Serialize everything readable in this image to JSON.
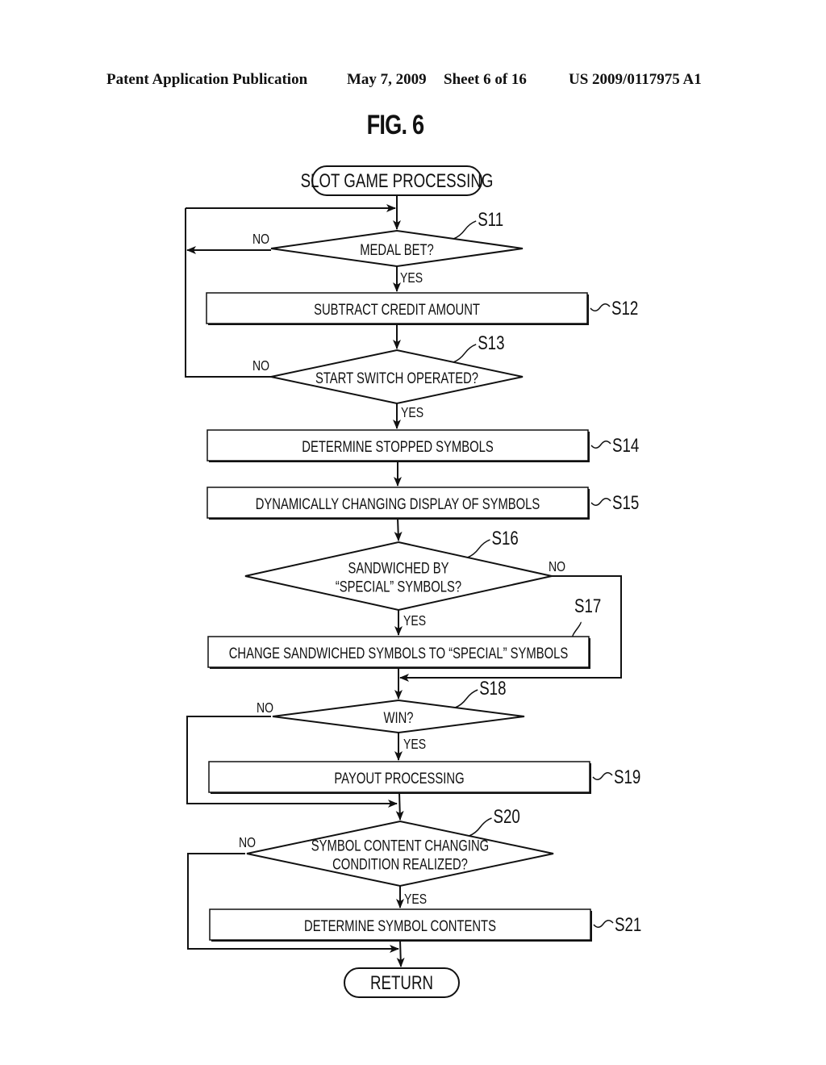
{
  "header": {
    "left": "Patent Application Publication",
    "date": "May 7, 2009",
    "sheet": "Sheet 6 of 16",
    "number": "US 2009/0117975 A1"
  },
  "figure": {
    "title": "FIG. 6"
  },
  "flowchart": {
    "start": "SLOT GAME PROCESSING",
    "end": "RETURN",
    "steps": {
      "S11": {
        "id": "S11",
        "type": "decision",
        "lines": [
          "MEDAL BET?"
        ],
        "yes": "YES",
        "no": "NO"
      },
      "S12": {
        "id": "S12",
        "type": "process",
        "lines": [
          "SUBTRACT CREDIT AMOUNT"
        ]
      },
      "S13": {
        "id": "S13",
        "type": "decision",
        "lines": [
          "START SWITCH OPERATED?"
        ],
        "yes": "YES",
        "no": "NO"
      },
      "S14": {
        "id": "S14",
        "type": "process",
        "lines": [
          "DETERMINE STOPPED SYMBOLS"
        ]
      },
      "S15": {
        "id": "S15",
        "type": "process",
        "lines": [
          "DYNAMICALLY CHANGING DISPLAY OF SYMBOLS"
        ]
      },
      "S16": {
        "id": "S16",
        "type": "decision",
        "lines": [
          "SANDWICHED BY",
          "“SPECIAL” SYMBOLS?"
        ],
        "yes": "YES",
        "no": "NO"
      },
      "S17": {
        "id": "S17",
        "type": "process",
        "lines": [
          "CHANGE SANDWICHED SYMBOLS TO “SPECIAL” SYMBOLS"
        ]
      },
      "S18": {
        "id": "S18",
        "type": "decision",
        "lines": [
          "WIN?"
        ],
        "yes": "YES",
        "no": "NO"
      },
      "S19": {
        "id": "S19",
        "type": "process",
        "lines": [
          "PAYOUT PROCESSING"
        ]
      },
      "S20": {
        "id": "S20",
        "type": "decision",
        "lines": [
          "SYMBOL CONTENT CHANGING",
          "CONDITION REALIZED?"
        ],
        "yes": "YES",
        "no": "NO"
      },
      "S21": {
        "id": "S21",
        "type": "process",
        "lines": [
          "DETERMINE SYMBOL CONTENTS"
        ]
      }
    }
  }
}
